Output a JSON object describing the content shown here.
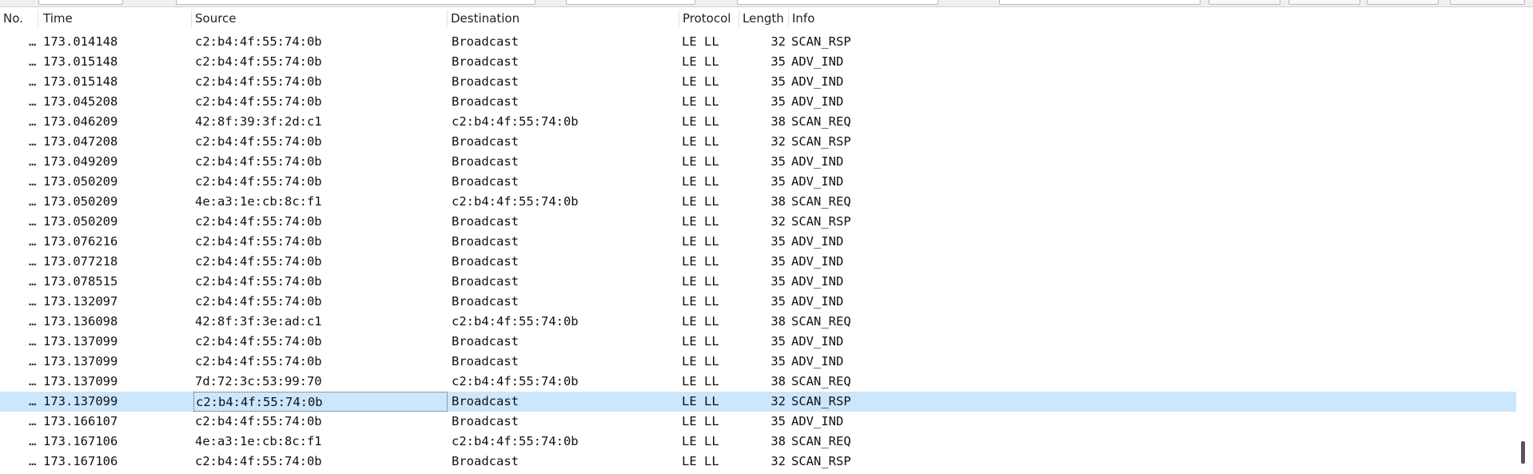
{
  "columns": {
    "no": "No.",
    "time": "Time",
    "source": "Source",
    "destination": "Destination",
    "protocol": "Protocol",
    "length": "Length",
    "info": "Info"
  },
  "packets": [
    {
      "no": "…",
      "time": "173.014148",
      "source": "c2:b4:4f:55:74:0b",
      "destination": "Broadcast",
      "protocol": "LE LL",
      "length": "32",
      "info": "SCAN_RSP"
    },
    {
      "no": "…",
      "time": "173.015148",
      "source": "c2:b4:4f:55:74:0b",
      "destination": "Broadcast",
      "protocol": "LE LL",
      "length": "35",
      "info": "ADV_IND"
    },
    {
      "no": "…",
      "time": "173.015148",
      "source": "c2:b4:4f:55:74:0b",
      "destination": "Broadcast",
      "protocol": "LE LL",
      "length": "35",
      "info": "ADV_IND"
    },
    {
      "no": "…",
      "time": "173.045208",
      "source": "c2:b4:4f:55:74:0b",
      "destination": "Broadcast",
      "protocol": "LE LL",
      "length": "35",
      "info": "ADV_IND"
    },
    {
      "no": "…",
      "time": "173.046209",
      "source": "42:8f:39:3f:2d:c1",
      "destination": "c2:b4:4f:55:74:0b",
      "protocol": "LE LL",
      "length": "38",
      "info": "SCAN_REQ"
    },
    {
      "no": "…",
      "time": "173.047208",
      "source": "c2:b4:4f:55:74:0b",
      "destination": "Broadcast",
      "protocol": "LE LL",
      "length": "32",
      "info": "SCAN_RSP"
    },
    {
      "no": "…",
      "time": "173.049209",
      "source": "c2:b4:4f:55:74:0b",
      "destination": "Broadcast",
      "protocol": "LE LL",
      "length": "35",
      "info": "ADV_IND"
    },
    {
      "no": "…",
      "time": "173.050209",
      "source": "c2:b4:4f:55:74:0b",
      "destination": "Broadcast",
      "protocol": "LE LL",
      "length": "35",
      "info": "ADV_IND"
    },
    {
      "no": "…",
      "time": "173.050209",
      "source": "4e:a3:1e:cb:8c:f1",
      "destination": "c2:b4:4f:55:74:0b",
      "protocol": "LE LL",
      "length": "38",
      "info": "SCAN_REQ"
    },
    {
      "no": "…",
      "time": "173.050209",
      "source": "c2:b4:4f:55:74:0b",
      "destination": "Broadcast",
      "protocol": "LE LL",
      "length": "32",
      "info": "SCAN_RSP"
    },
    {
      "no": "…",
      "time": "173.076216",
      "source": "c2:b4:4f:55:74:0b",
      "destination": "Broadcast",
      "protocol": "LE LL",
      "length": "35",
      "info": "ADV_IND"
    },
    {
      "no": "…",
      "time": "173.077218",
      "source": "c2:b4:4f:55:74:0b",
      "destination": "Broadcast",
      "protocol": "LE LL",
      "length": "35",
      "info": "ADV_IND"
    },
    {
      "no": "…",
      "time": "173.078515",
      "source": "c2:b4:4f:55:74:0b",
      "destination": "Broadcast",
      "protocol": "LE LL",
      "length": "35",
      "info": "ADV_IND"
    },
    {
      "no": "…",
      "time": "173.132097",
      "source": "c2:b4:4f:55:74:0b",
      "destination": "Broadcast",
      "protocol": "LE LL",
      "length": "35",
      "info": "ADV_IND"
    },
    {
      "no": "…",
      "time": "173.136098",
      "source": "42:8f:3f:3e:ad:c1",
      "destination": "c2:b4:4f:55:74:0b",
      "protocol": "LE LL",
      "length": "38",
      "info": "SCAN_REQ"
    },
    {
      "no": "…",
      "time": "173.137099",
      "source": "c2:b4:4f:55:74:0b",
      "destination": "Broadcast",
      "protocol": "LE LL",
      "length": "35",
      "info": "ADV_IND"
    },
    {
      "no": "…",
      "time": "173.137099",
      "source": "c2:b4:4f:55:74:0b",
      "destination": "Broadcast",
      "protocol": "LE LL",
      "length": "35",
      "info": "ADV_IND"
    },
    {
      "no": "…",
      "time": "173.137099",
      "source": "7d:72:3c:53:99:70",
      "destination": "c2:b4:4f:55:74:0b",
      "protocol": "LE LL",
      "length": "38",
      "info": "SCAN_REQ"
    },
    {
      "no": "…",
      "time": "173.137099",
      "source": "c2:b4:4f:55:74:0b",
      "destination": "Broadcast",
      "protocol": "LE LL",
      "length": "32",
      "info": "SCAN_RSP",
      "selected": true
    },
    {
      "no": "…",
      "time": "173.166107",
      "source": "c2:b4:4f:55:74:0b",
      "destination": "Broadcast",
      "protocol": "LE LL",
      "length": "35",
      "info": "ADV_IND"
    },
    {
      "no": "…",
      "time": "173.167106",
      "source": "4e:a3:1e:cb:8c:f1",
      "destination": "c2:b4:4f:55:74:0b",
      "protocol": "LE LL",
      "length": "38",
      "info": "SCAN_REQ"
    },
    {
      "no": "…",
      "time": "173.167106",
      "source": "c2:b4:4f:55:74:0b",
      "destination": "Broadcast",
      "protocol": "LE LL",
      "length": "32",
      "info": "SCAN_RSP"
    }
  ],
  "colors": {
    "selected_row": "#cce6fb",
    "header_border": "#e2e2e2",
    "text": "#111111"
  }
}
